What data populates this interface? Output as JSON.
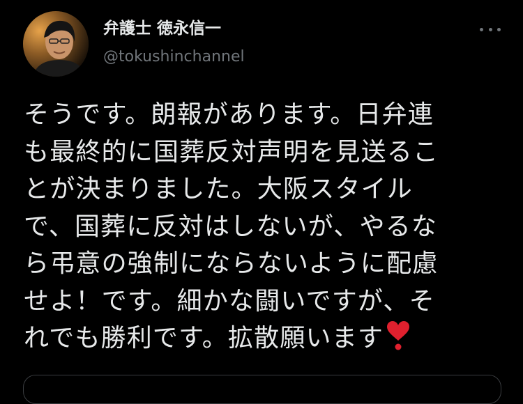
{
  "author": {
    "display_name": "弁護士 徳永信一",
    "handle": "@tokushinchannel"
  },
  "tweet": {
    "lines": [
      "そうです。朗報があります。日弁連",
      "も最終的に国葬反対声明を見送るこ",
      "とが決まりました。大阪スタイル",
      "で、国葬に反対はしないが、やるな",
      "ら弔意の強制にならないように配慮",
      "せよ！です。細かな闘いですが、そ",
      "れでも勝利です。拡散願います"
    ],
    "trailing_emoji": "heavy-heart-exclamation-icon"
  },
  "colors": {
    "background": "#000000",
    "text": "#e7e9ea",
    "secondary": "#71767b",
    "heart": "#e0202e"
  }
}
